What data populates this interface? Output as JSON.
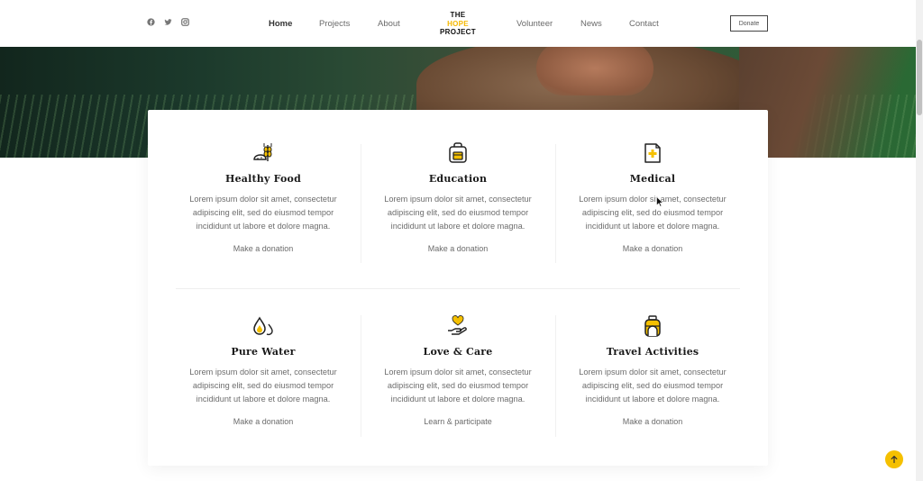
{
  "header": {
    "social": [
      "facebook-icon",
      "twitter-icon",
      "instagram-icon"
    ],
    "nav": {
      "home": "Home",
      "projects": "Projects",
      "about": "About",
      "volunteer": "Volunteer",
      "news": "News",
      "contact": "Contact"
    },
    "logo": {
      "line1": "THE",
      "line2": "HOPE",
      "line3": "PROJECT"
    },
    "donate_label": "Donate"
  },
  "features": [
    {
      "icon": "wheat-bread-icon",
      "title": "Healthy Food",
      "text": "Lorem ipsum dolor sit amet, consectetur adipiscing elit, sed do eiusmod tempor incididunt ut labore et dolore magna.",
      "link": "Make a donation"
    },
    {
      "icon": "backpack-icon",
      "title": "Education",
      "text": "Lorem ipsum dolor sit amet, consectetur adipiscing elit, sed do eiusmod tempor incididunt ut labore et dolore magna.",
      "link": "Make a donation"
    },
    {
      "icon": "medical-document-icon",
      "title": "Medical",
      "text": "Lorem ipsum dolor sit amet, consectetur adipiscing elit, sed do eiusmod tempor incididunt ut labore et dolore magna.",
      "link": "Make a donation"
    },
    {
      "icon": "water-drops-icon",
      "title": "Pure Water",
      "text": "Lorem ipsum dolor sit amet, consectetur adipiscing elit, sed do eiusmod tempor incididunt ut labore et dolore magna.",
      "link": "Make a donation"
    },
    {
      "icon": "heart-hand-icon",
      "title": "Love & Care",
      "text": "Lorem ipsum dolor sit amet, consectetur adipiscing elit, sed do eiusmod tempor incididunt ut labore et dolore magna.",
      "link": "Learn & participate"
    },
    {
      "icon": "travel-backpack-icon",
      "title": "Travel Activities",
      "text": "Lorem ipsum dolor sit amet, consectetur adipiscing elit, sed do eiusmod tempor incididunt ut labore et dolore magna.",
      "link": "Make a donation"
    }
  ],
  "back_to_top_icon": "arrow-up-icon",
  "colors": {
    "accent": "#f5c000",
    "text_dark": "#1a1a1a",
    "text_muted": "#6d6d6d"
  }
}
